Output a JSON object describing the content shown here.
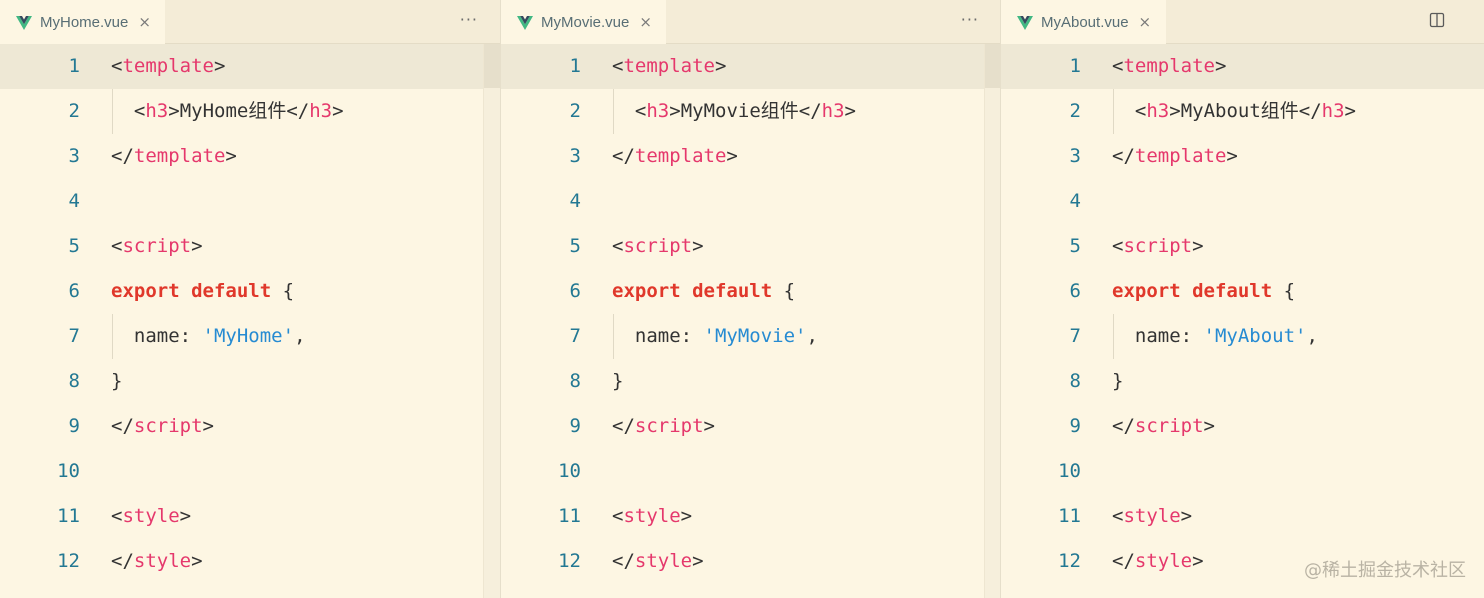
{
  "panes": [
    {
      "tab_label": "MyHome.vue",
      "close_glyph": "×",
      "more_glyph": "···",
      "line_numbers": [
        "1",
        "2",
        "3",
        "4",
        "5",
        "6",
        "7",
        "8",
        "9",
        "10",
        "11",
        "12"
      ],
      "component_text": "MyHome组件",
      "name_value": "'MyHome'"
    },
    {
      "tab_label": "MyMovie.vue",
      "close_glyph": "×",
      "more_glyph": "···",
      "line_numbers": [
        "1",
        "2",
        "3",
        "4",
        "5",
        "6",
        "7",
        "8",
        "9",
        "10",
        "11",
        "12"
      ],
      "component_text": "MyMovie组件",
      "name_value": "'MyMovie'"
    },
    {
      "tab_label": "MyAbout.vue",
      "close_glyph": "×",
      "more_glyph": "···",
      "line_numbers": [
        "1",
        "2",
        "3",
        "4",
        "5",
        "6",
        "7",
        "8",
        "9",
        "10",
        "11",
        "12"
      ],
      "component_text": "MyAbout组件",
      "name_value": "'MyAbout'"
    }
  ],
  "code": {
    "lt": "<",
    "gt": ">",
    "lt_slash": "</",
    "template": "template",
    "h3": "h3",
    "script": "script",
    "style": "style",
    "export": "export",
    "default": "default",
    "open_brace": "{",
    "close_brace": "}",
    "name_key": "name:",
    "comma": ","
  },
  "watermark": "@稀土掘金技术社区",
  "icons": {
    "vue": "vue-logo-icon",
    "close": "close-icon",
    "more": "more-actions-icon",
    "split": "split-editor-icon"
  },
  "colors": {
    "background": "#fdf6e3",
    "line_highlight": "#eee8d5",
    "tag": "#e5386c",
    "keyword": "#e0382b",
    "string": "#268bd2",
    "line_number": "#237893"
  }
}
